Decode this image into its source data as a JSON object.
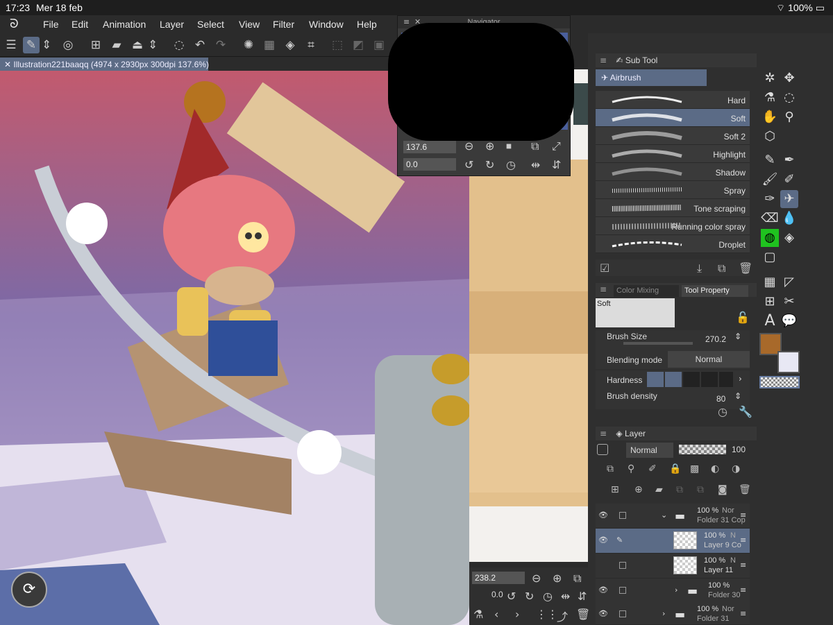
{
  "status": {
    "time": "17:23",
    "date": "Mer 18 feb",
    "battery": "100%"
  },
  "menu": [
    "File",
    "Edit",
    "Animation",
    "Layer",
    "Select",
    "View",
    "Filter",
    "Window",
    "Help"
  ],
  "doc_tab": {
    "title": "Illustration221baaqq (4974 x 2930px 300dpi 137.6%)"
  },
  "navigator": {
    "title": "Navigator",
    "zoom": "137.6",
    "rotation": "0.0"
  },
  "subtool": {
    "panel_title": "Sub Tool",
    "group": "Airbrush",
    "items": [
      {
        "label": "Hard"
      },
      {
        "label": "Soft"
      },
      {
        "label": "Soft 2"
      },
      {
        "label": "Highlight"
      },
      {
        "label": "Shadow"
      },
      {
        "label": "Spray"
      },
      {
        "label": "Tone scraping"
      },
      {
        "label": "Running color spray"
      },
      {
        "label": "Droplet"
      }
    ]
  },
  "tool_property": {
    "tabs": [
      "Color Mixing",
      "Tool Property"
    ],
    "preset": "Soft",
    "brush_size_label": "Brush Size",
    "brush_size": "270.2",
    "blending_label": "Blending mode",
    "blending": "Normal",
    "hardness_label": "Hardness",
    "density_label": "Brush density",
    "density": "80"
  },
  "layer": {
    "panel_title": "Layer",
    "blend": "Normal",
    "opacity": "100",
    "rows": [
      {
        "pct": "100 %",
        "mode": "Nor",
        "name": "Folder 31 Cop"
      },
      {
        "pct": "100 %",
        "mode": "N",
        "name": "Layer 9 Co"
      },
      {
        "pct": "100 %",
        "mode": "N",
        "name": "Layer 11"
      },
      {
        "pct": "100 %",
        "mode": "",
        "name": "Folder 30"
      },
      {
        "pct": "100 %",
        "mode": "Nor",
        "name": "Folder 31"
      }
    ]
  },
  "bottom_nav": {
    "zoom": "238.2",
    "rotation": "0.0"
  },
  "colors": {
    "main": "#a8692a",
    "sub": "#e8e8f4",
    "accent": "#5b6b86"
  }
}
